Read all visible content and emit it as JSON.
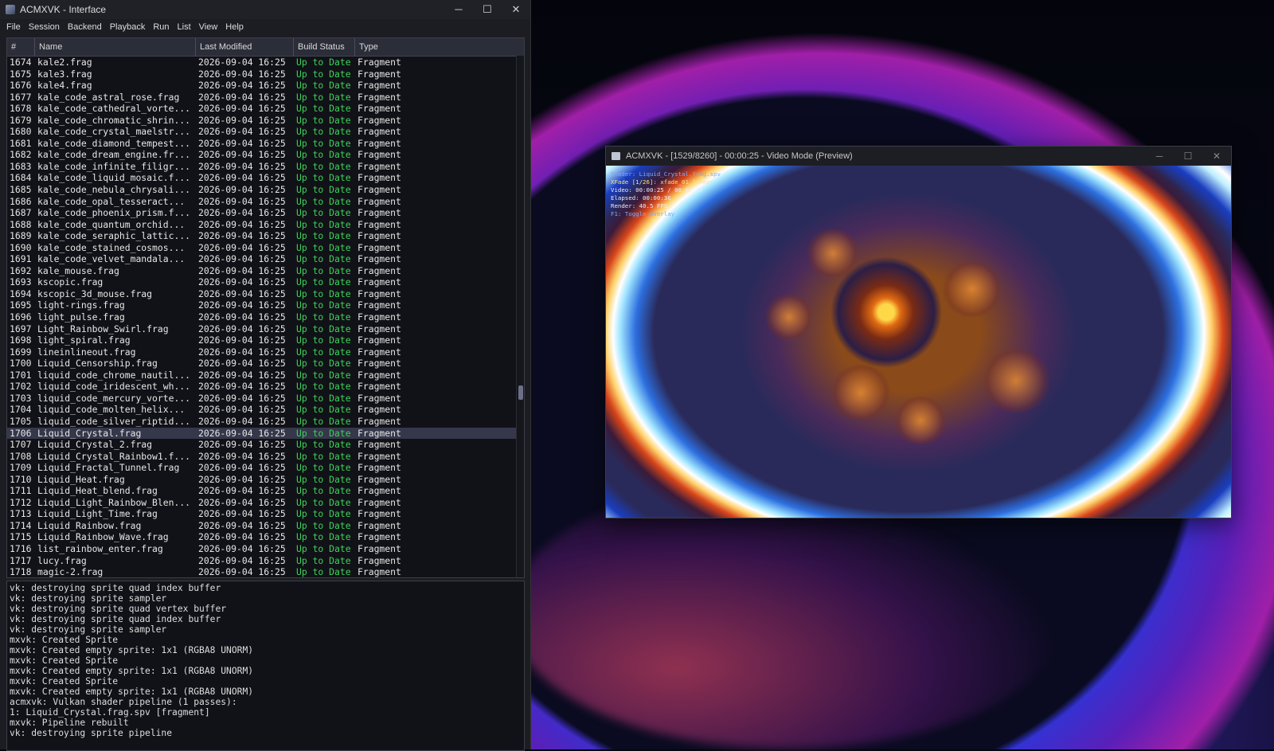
{
  "main_window": {
    "title": "ACMXVK - Interface",
    "controls": {
      "minimize": "─",
      "maximize": "☐",
      "close": "✕"
    },
    "menu": [
      "File",
      "Session",
      "Backend",
      "Playback",
      "Run",
      "List",
      "View",
      "Help"
    ]
  },
  "table": {
    "columns": [
      "#",
      "Name",
      "Last Modified",
      "Build Status",
      "Type"
    ],
    "selected_index": 32,
    "rows": [
      [
        "1674",
        "kale2.frag",
        "2026-09-04 16:25",
        "Up to Date",
        "Fragment"
      ],
      [
        "1675",
        "kale3.frag",
        "2026-09-04 16:25",
        "Up to Date",
        "Fragment"
      ],
      [
        "1676",
        "kale4.frag",
        "2026-09-04 16:25",
        "Up to Date",
        "Fragment"
      ],
      [
        "1677",
        "kale_code_astral_rose.frag",
        "2026-09-04 16:25",
        "Up to Date",
        "Fragment"
      ],
      [
        "1678",
        "kale_code_cathedral_vorte...",
        "2026-09-04 16:25",
        "Up to Date",
        "Fragment"
      ],
      [
        "1679",
        "kale_code_chromatic_shrin...",
        "2026-09-04 16:25",
        "Up to Date",
        "Fragment"
      ],
      [
        "1680",
        "kale_code_crystal_maelstr...",
        "2026-09-04 16:25",
        "Up to Date",
        "Fragment"
      ],
      [
        "1681",
        "kale_code_diamond_tempest...",
        "2026-09-04 16:25",
        "Up to Date",
        "Fragment"
      ],
      [
        "1682",
        "kale_code_dream_engine.fr...",
        "2026-09-04 16:25",
        "Up to Date",
        "Fragment"
      ],
      [
        "1683",
        "kale_code_infinite_filigr...",
        "2026-09-04 16:25",
        "Up to Date",
        "Fragment"
      ],
      [
        "1684",
        "kale_code_liquid_mosaic.f...",
        "2026-09-04 16:25",
        "Up to Date",
        "Fragment"
      ],
      [
        "1685",
        "kale_code_nebula_chrysali...",
        "2026-09-04 16:25",
        "Up to Date",
        "Fragment"
      ],
      [
        "1686",
        "kale_code_opal_tesseract...",
        "2026-09-04 16:25",
        "Up to Date",
        "Fragment"
      ],
      [
        "1687",
        "kale_code_phoenix_prism.f...",
        "2026-09-04 16:25",
        "Up to Date",
        "Fragment"
      ],
      [
        "1688",
        "kale_code_quantum_orchid...",
        "2026-09-04 16:25",
        "Up to Date",
        "Fragment"
      ],
      [
        "1689",
        "kale_code_seraphic_lattic...",
        "2026-09-04 16:25",
        "Up to Date",
        "Fragment"
      ],
      [
        "1690",
        "kale_code_stained_cosmos...",
        "2026-09-04 16:25",
        "Up to Date",
        "Fragment"
      ],
      [
        "1691",
        "kale_code_velvet_mandala...",
        "2026-09-04 16:25",
        "Up to Date",
        "Fragment"
      ],
      [
        "1692",
        "kale_mouse.frag",
        "2026-09-04 16:25",
        "Up to Date",
        "Fragment"
      ],
      [
        "1693",
        "kscopic.frag",
        "2026-09-04 16:25",
        "Up to Date",
        "Fragment"
      ],
      [
        "1694",
        "kscopic_3d_mouse.frag",
        "2026-09-04 16:25",
        "Up to Date",
        "Fragment"
      ],
      [
        "1695",
        "light-rings.frag",
        "2026-09-04 16:25",
        "Up to Date",
        "Fragment"
      ],
      [
        "1696",
        "light_pulse.frag",
        "2026-09-04 16:25",
        "Up to Date",
        "Fragment"
      ],
      [
        "1697",
        "Light_Rainbow_Swirl.frag",
        "2026-09-04 16:25",
        "Up to Date",
        "Fragment"
      ],
      [
        "1698",
        "light_spiral.frag",
        "2026-09-04 16:25",
        "Up to Date",
        "Fragment"
      ],
      [
        "1699",
        "lineinlineout.frag",
        "2026-09-04 16:25",
        "Up to Date",
        "Fragment"
      ],
      [
        "1700",
        "Liquid_Censorship.frag",
        "2026-09-04 16:25",
        "Up to Date",
        "Fragment"
      ],
      [
        "1701",
        "liquid_code_chrome_nautil...",
        "2026-09-04 16:25",
        "Up to Date",
        "Fragment"
      ],
      [
        "1702",
        "liquid_code_iridescent_wh...",
        "2026-09-04 16:25",
        "Up to Date",
        "Fragment"
      ],
      [
        "1703",
        "liquid_code_mercury_vorte...",
        "2026-09-04 16:25",
        "Up to Date",
        "Fragment"
      ],
      [
        "1704",
        "liquid_code_molten_helix...",
        "2026-09-04 16:25",
        "Up to Date",
        "Fragment"
      ],
      [
        "1705",
        "liquid_code_silver_riptid...",
        "2026-09-04 16:25",
        "Up to Date",
        "Fragment"
      ],
      [
        "1706",
        "Liquid_Crystal.frag",
        "2026-09-04 16:25",
        "Up to Date",
        "Fragment"
      ],
      [
        "1707",
        "Liquid_Crystal_2.frag",
        "2026-09-04 16:25",
        "Up to Date",
        "Fragment"
      ],
      [
        "1708",
        "Liquid_Crystal_Rainbow1.f...",
        "2026-09-04 16:25",
        "Up to Date",
        "Fragment"
      ],
      [
        "1709",
        "Liquid_Fractal_Tunnel.frag",
        "2026-09-04 16:25",
        "Up to Date",
        "Fragment"
      ],
      [
        "1710",
        "Liquid_Heat.frag",
        "2026-09-04 16:25",
        "Up to Date",
        "Fragment"
      ],
      [
        "1711",
        "Liquid_Heat_blend.frag",
        "2026-09-04 16:25",
        "Up to Date",
        "Fragment"
      ],
      [
        "1712",
        "Liquid_Light_Rainbow_Blen...",
        "2026-09-04 16:25",
        "Up to Date",
        "Fragment"
      ],
      [
        "1713",
        "Liquid_Light_Time.frag",
        "2026-09-04 16:25",
        "Up to Date",
        "Fragment"
      ],
      [
        "1714",
        "Liquid_Rainbow.frag",
        "2026-09-04 16:25",
        "Up to Date",
        "Fragment"
      ],
      [
        "1715",
        "Liquid_Rainbow_Wave.frag",
        "2026-09-04 16:25",
        "Up to Date",
        "Fragment"
      ],
      [
        "1716",
        "list_rainbow_enter.frag",
        "2026-09-04 16:25",
        "Up to Date",
        "Fragment"
      ],
      [
        "1717",
        "lucy.frag",
        "2026-09-04 16:25",
        "Up to Date",
        "Fragment"
      ],
      [
        "1718",
        "magic-2.frag",
        "2026-09-04 16:25",
        "Up to Date",
        "Fragment"
      ]
    ]
  },
  "log": {
    "lines": [
      "vk: destroying sprite quad index buffer",
      "vk: destroying sprite sampler",
      "vk: destroying sprite quad vertex buffer",
      "vk: destroying sprite quad index buffer",
      "vk: destroying sprite sampler",
      "mxvk: Created Sprite",
      "mxvk: Created empty sprite: 1x1 (RGBA8 UNORM)",
      "mxvk: Created Sprite",
      "mxvk: Created empty sprite: 1x1 (RGBA8 UNORM)",
      "mxvk: Created Sprite",
      "mxvk: Created empty sprite: 1x1 (RGBA8 UNORM)",
      "acmxvk: Vulkan shader pipeline (1 passes):",
      "1: Liquid_Crystal.frag.spv [fragment]",
      "mxvk: Pipeline rebuilt",
      "vk: destroying sprite pipeline"
    ]
  },
  "preview_window": {
    "title": "ACMXVK - [1529/8260] - 00:00:25 - Video Mode (Preview)",
    "controls": {
      "minimize": "─",
      "maximize": "☐",
      "close": "✕"
    },
    "overlay": [
      "Shader: Liquid_Crystal.frag.spv",
      "XFade [1/26]: xfade_01_linear",
      "Video: 00:00:25 / 00:02:17",
      "Elapsed: 00:00:36",
      "Render: 40.5 FPS",
      "F1: Toggle overlay"
    ]
  },
  "colors": {
    "status_green": "#3dd25a",
    "window_bg": "#1c1d22",
    "selected_row": "#35374a"
  }
}
